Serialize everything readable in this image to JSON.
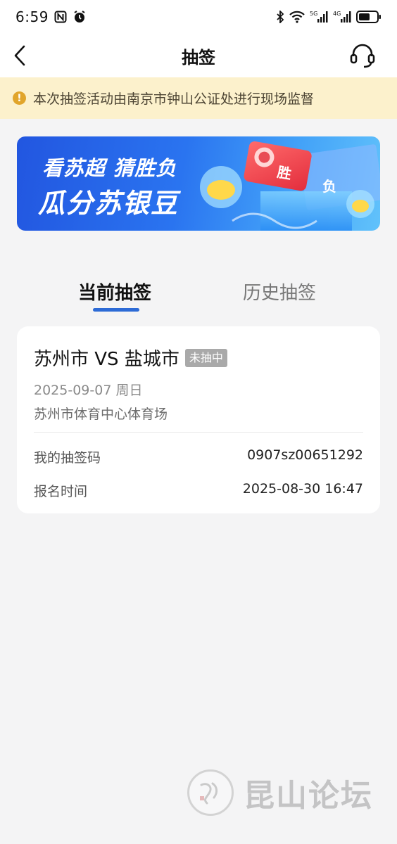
{
  "status_bar": {
    "time": "6:59",
    "icons_left": [
      "nfc-icon",
      "alarm-icon"
    ],
    "icons_right": [
      "bluetooth-icon",
      "wifi-icon",
      "signal-5g-icon",
      "signal-4g-icon",
      "battery-icon"
    ],
    "signal_5g_label": "5G",
    "signal_4g_label": "4G"
  },
  "nav": {
    "title": "抽签",
    "back_icon": "chevron-left-icon",
    "service_icon": "headset-icon"
  },
  "notice": {
    "icon": "exclamation-circle-icon",
    "text": "本次抽签活动由南京市钟山公证处进行现场监督"
  },
  "banner": {
    "line1": "看苏超 猜胜负",
    "line2": "瓜分苏银豆",
    "tag_win": "胜",
    "tag_lose": "负"
  },
  "tabs": [
    {
      "label": "当前抽签",
      "active": true
    },
    {
      "label": "历史抽签",
      "active": false
    }
  ],
  "card": {
    "title": "苏州市 VS 盐城市",
    "status_badge": "未抽中",
    "date": "2025-09-07 周日",
    "venue": "苏州市体育中心体育场",
    "code_label": "我的抽签码",
    "code_value": "0907sz00651292",
    "signup_label": "报名时间",
    "signup_value": "2025-08-30 16:47"
  },
  "watermark": {
    "text": "昆山论坛"
  },
  "colors": {
    "accent": "#2d6bd6",
    "notice_bg": "#fcf1cc",
    "notice_icon": "#e1a52a",
    "badge_bg": "#a9a9a9",
    "page_bg": "#f4f4f5"
  }
}
